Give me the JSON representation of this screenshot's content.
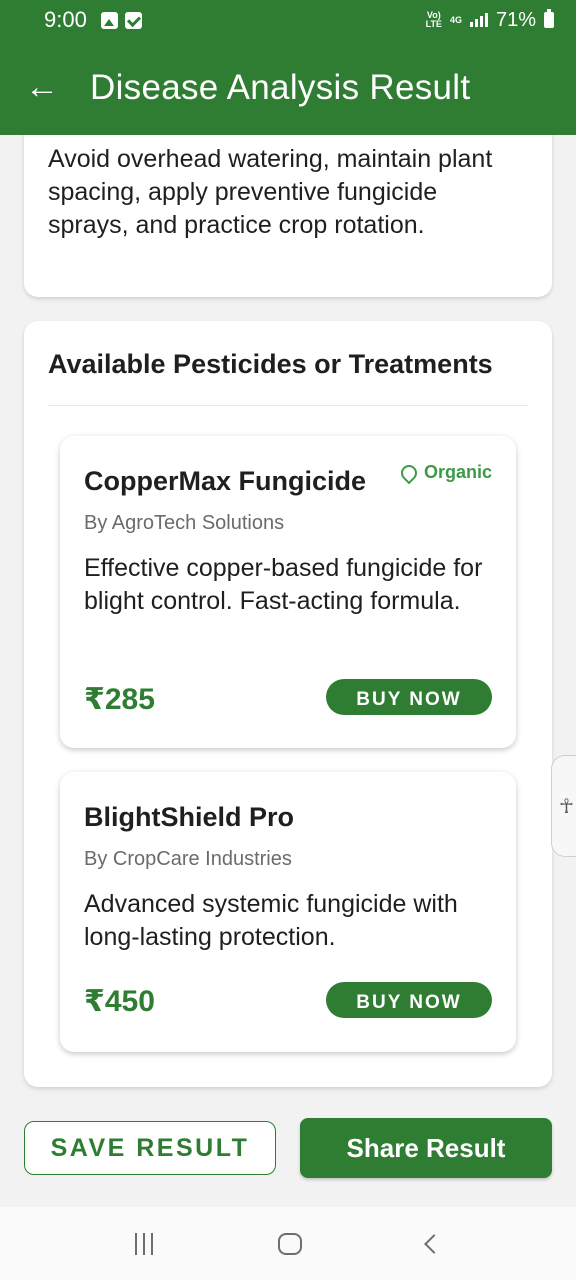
{
  "status_bar": {
    "time": "9:00",
    "network_top": "Vo)",
    "network_bottom": "LTE",
    "network_gen": "4G",
    "battery": "71%",
    "icons": [
      "image-icon",
      "check-icon",
      "signal-icon",
      "battery-icon"
    ]
  },
  "app_bar": {
    "back_icon": "arrow-left-icon",
    "title": "Disease Analysis Result"
  },
  "prevention": {
    "text": "Avoid overhead watering, maintain plant spacing, apply preventive fungicide sprays, and practice crop rotation."
  },
  "treatments": {
    "title": "Available Pesticides or Treatments",
    "products": [
      {
        "name": "CopperMax Fungicide",
        "badge": "Organic",
        "badge_icon": "leaf-icon",
        "vendor": "By AgroTech Solutions",
        "description": "Effective copper-based fungicide for blight control. Fast-acting formula.",
        "price": "₹285",
        "buy_label": "BUY NOW"
      },
      {
        "name": "BlightShield Pro",
        "vendor": "By CropCare Industries",
        "description": "Advanced systemic fungicide with long-lasting protection.",
        "price": "₹450",
        "buy_label": "BUY NOW"
      }
    ]
  },
  "actions": {
    "save_label": "SAVE RESULT",
    "share_label": "Share Result"
  },
  "accessibility_icon": "accessibility-icon",
  "nav_bar": {
    "icons": [
      "recent-apps-icon",
      "home-icon",
      "back-icon"
    ]
  },
  "colors": {
    "primary": "#2e7d32",
    "organic": "#3d9a45",
    "background": "#f2f2f2"
  }
}
